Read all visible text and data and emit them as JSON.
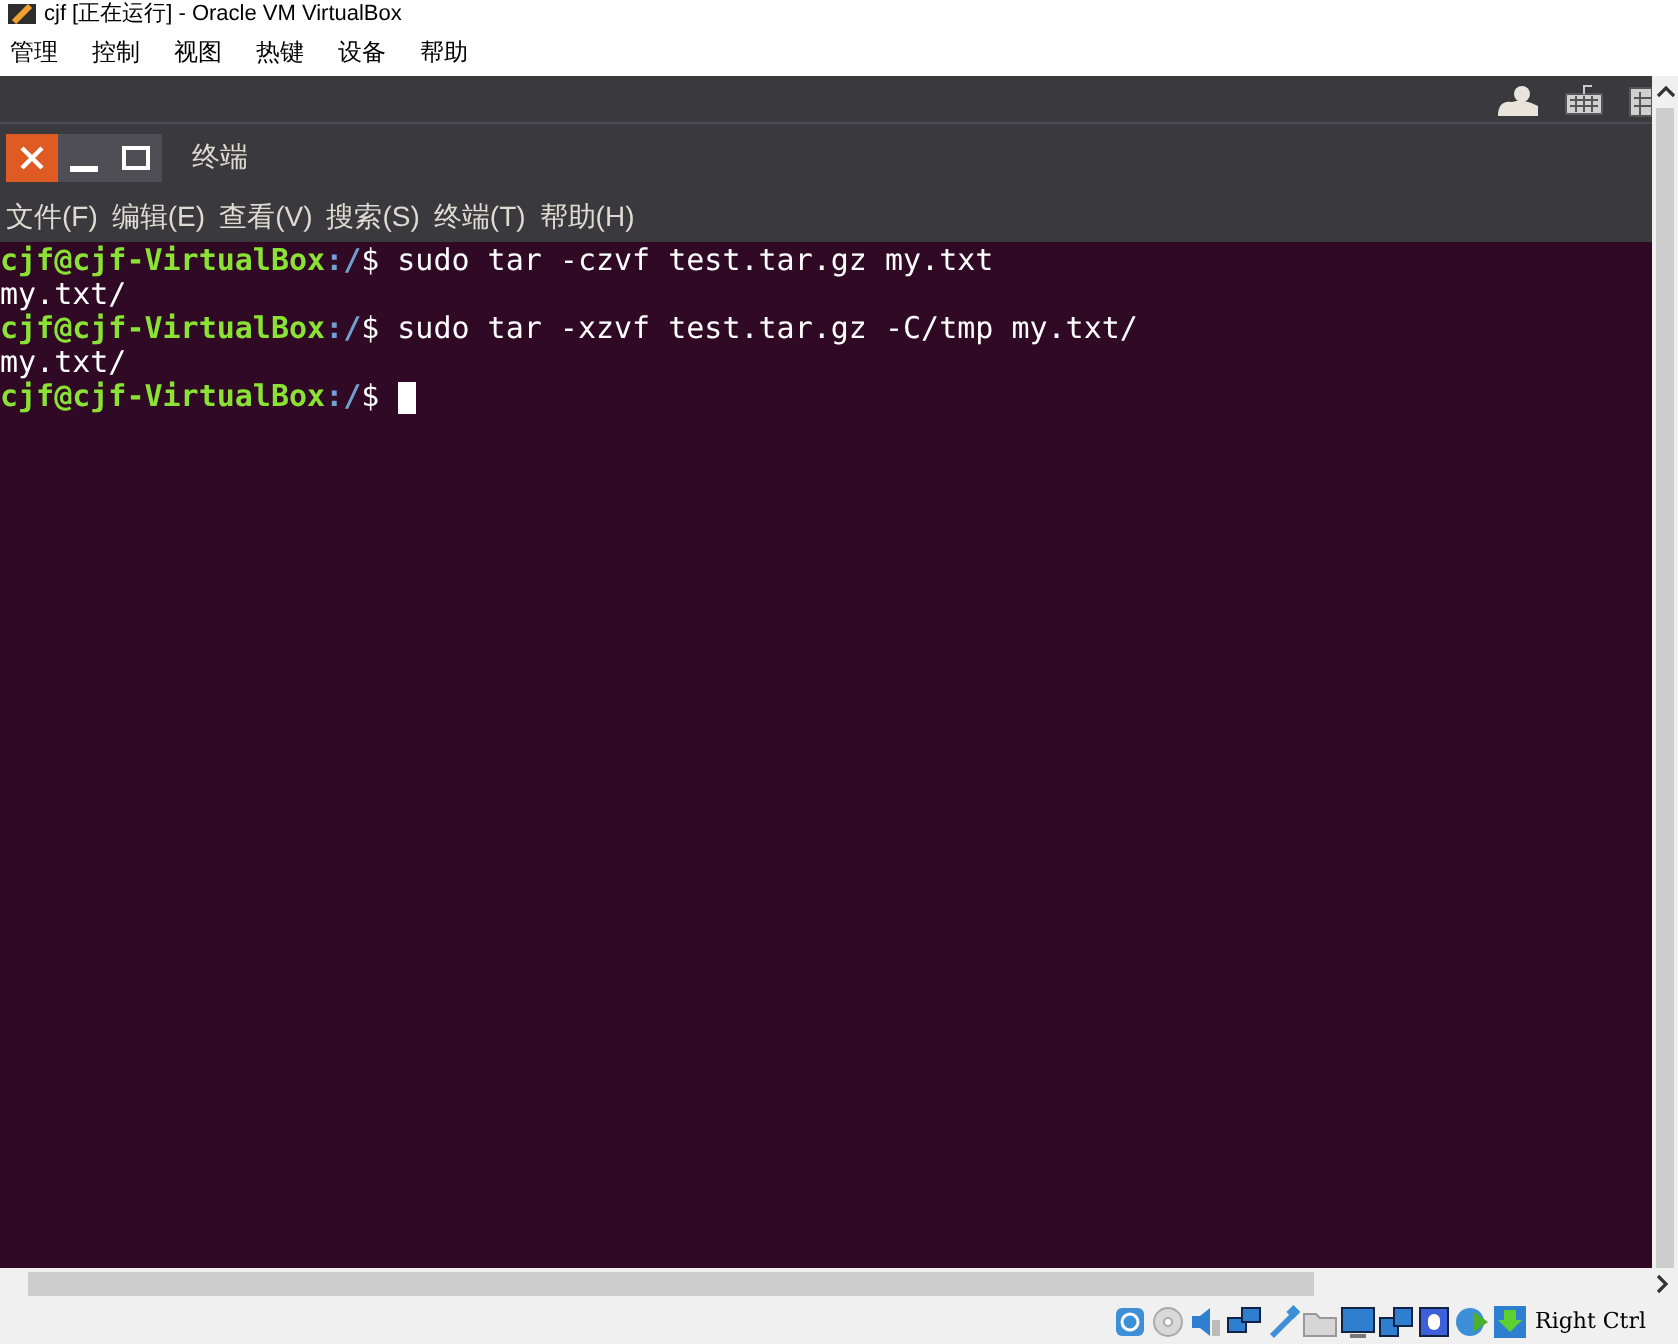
{
  "window": {
    "title": "cjf [正在运行] - Oracle VM VirtualBox"
  },
  "menu": [
    "管理",
    "控制",
    "视图",
    "热键",
    "设备",
    "帮助"
  ],
  "terminal_window": {
    "title": "终端",
    "menu": [
      "文件(F)",
      "编辑(E)",
      "查看(V)",
      "搜索(S)",
      "终端(T)",
      "帮助(H)"
    ]
  },
  "terminal_lines": [
    {
      "kind": "prompt",
      "user_host": "cjf@cjf-VirtualBox",
      "path": ":/",
      "symbol": "$",
      "command": "sudo tar -czvf test.tar.gz my.txt",
      "cursor": false
    },
    {
      "kind": "output",
      "text": "my.txt/"
    },
    {
      "kind": "prompt",
      "user_host": "cjf@cjf-VirtualBox",
      "path": ":/",
      "symbol": "$",
      "command": "sudo tar -xzvf test.tar.gz -C/tmp my.txt/",
      "cursor": false
    },
    {
      "kind": "output",
      "text": "my.txt/"
    },
    {
      "kind": "prompt",
      "user_host": "cjf@cjf-VirtualBox",
      "path": ":/",
      "symbol": "$",
      "cursor": true
    }
  ],
  "status_bar": {
    "host_key": "Right Ctrl"
  }
}
